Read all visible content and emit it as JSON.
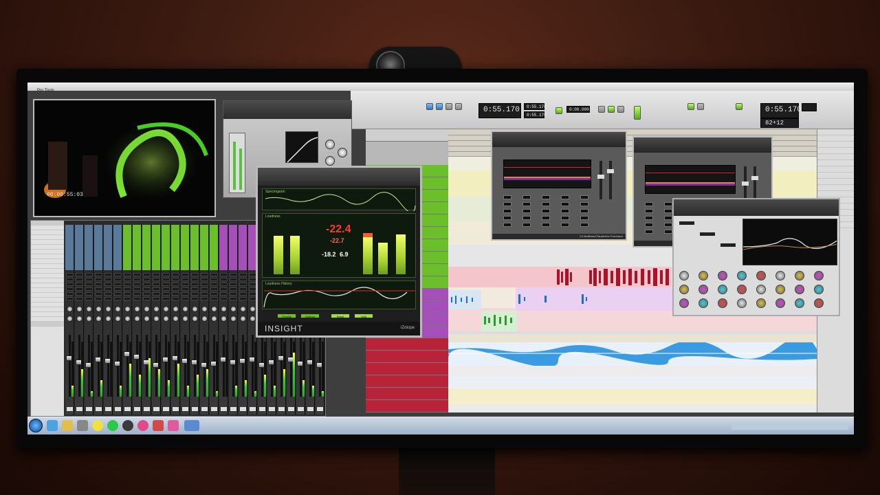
{
  "app": {
    "title": "Pro Tools",
    "menu": [
      "File",
      "Edit",
      "View",
      "Track",
      "Clip",
      "Event",
      "AudioSuite",
      "Options",
      "Setup",
      "Window",
      "Help"
    ]
  },
  "video": {
    "timecode": "00:00:55:03"
  },
  "transport": {
    "main_counter": "0:55.170",
    "right_counter": "0:55.170",
    "right_sub": "82+12",
    "start": "0:55.170",
    "end": "0:55.170",
    "length": "0:00.000"
  },
  "insight": {
    "title": "Insight",
    "brand": "INSIGHT",
    "maker": "iZotope",
    "panels": {
      "top": "Spectrogram",
      "mid": "Loudness",
      "bottom": "Loudness History"
    },
    "readouts": {
      "integrated": "-22.4",
      "short_term": "-22.7",
      "range": "-18.2",
      "true_peak": "6.9"
    },
    "labels": {
      "integrated": "Integrated (LUFS)",
      "short_term": "Short-term (LUFS)",
      "range": "Loudness Range",
      "true_peak": "True Peak"
    },
    "buttons": [
      "Presets",
      "Options",
      "Reset",
      "Hold"
    ]
  },
  "multiband": [
    {
      "name": "C4 Multiband Parametric Processor"
    },
    {
      "name": "C4 Multiband Parametric Processor"
    }
  ],
  "colors": {
    "accent_green": "#6bbf2a",
    "track_purple": "#a450b8",
    "audio_blue": "#3b9be0",
    "audio_red": "#b8233a",
    "insight_bar": "#a8d033"
  },
  "taskbar": {
    "icons": [
      "start-orb",
      "ie-icon",
      "explorer-icon",
      "media-icon",
      "chrome-icon",
      "spotify-icon",
      "protools-icon",
      "itunes-icon",
      "firefox-icon"
    ]
  }
}
